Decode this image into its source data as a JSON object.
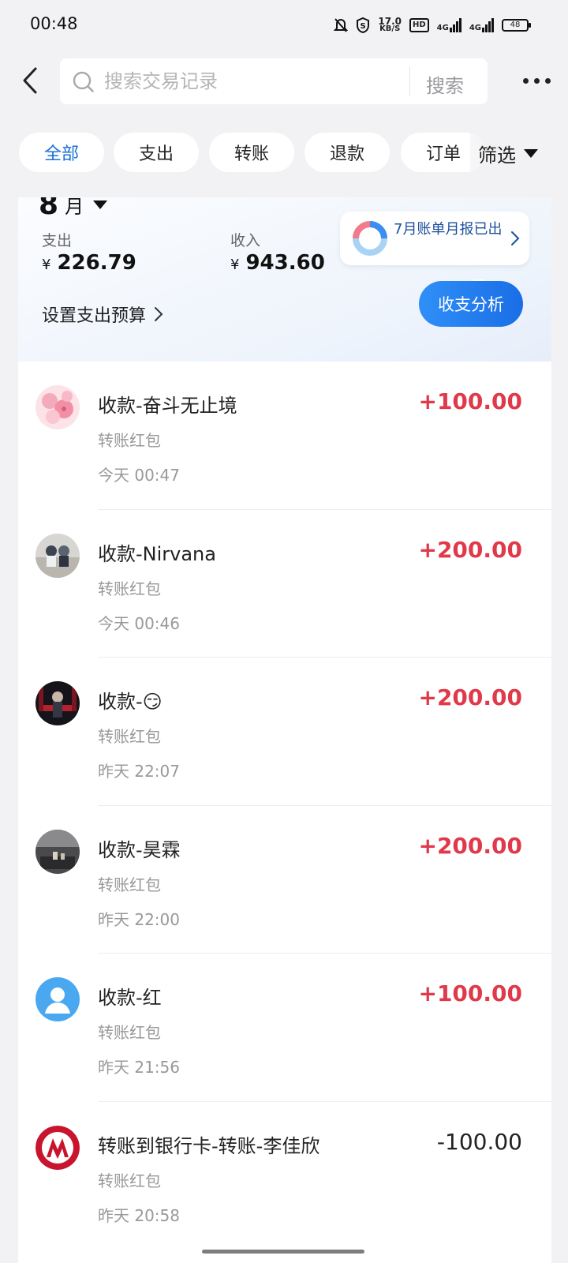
{
  "status_bar": {
    "time": "00:48",
    "net_speed_value": "17.0",
    "net_speed_unit": "KB/S",
    "hd_badge": "HD",
    "signal1": "4G",
    "signal2": "4G",
    "battery": "48"
  },
  "header": {
    "search_placeholder": "搜索交易记录",
    "search_button": "搜索"
  },
  "tabs": [
    {
      "label": "全部",
      "active": true
    },
    {
      "label": "支出",
      "active": false
    },
    {
      "label": "转账",
      "active": false
    },
    {
      "label": "退款",
      "active": false
    },
    {
      "label": "订单",
      "active": false
    }
  ],
  "filter_label": "筛选",
  "summary": {
    "month_number": "8",
    "month_unit": "月",
    "expense_label": "支出",
    "expense_currency": "¥",
    "expense_value": "226.79",
    "income_label": "收入",
    "income_currency": "¥",
    "income_value": "943.60",
    "report_text": "7月账单月报已出",
    "budget_label": "设置支出预算",
    "analysis_button": "收支分析"
  },
  "transactions": [
    {
      "title": "收款-奋斗无止境",
      "subtitle": "转账红包",
      "time": "今天 00:47",
      "amount": "+100.00",
      "direction": "in",
      "avatar": "pink-blossom"
    },
    {
      "title": "收款-Nirvana",
      "subtitle": "转账红包",
      "time": "今天 00:46",
      "amount": "+200.00",
      "direction": "in",
      "avatar": "figurine-photo"
    },
    {
      "title": "收款-😏",
      "subtitle": "转账红包",
      "time": "昨天 22:07",
      "amount": "+200.00",
      "direction": "in",
      "avatar": "stage-photo"
    },
    {
      "title": "收款-昊霖",
      "subtitle": "转账红包",
      "time": "昨天 22:00",
      "amount": "+200.00",
      "direction": "in",
      "avatar": "dark-photo"
    },
    {
      "title": "收款-红",
      "subtitle": "转账红包",
      "time": "昨天 21:56",
      "amount": "+100.00",
      "direction": "in",
      "avatar": "default-user"
    },
    {
      "title": "转账到银行卡-转账-李佳欣",
      "subtitle": "转账红包",
      "time": "昨天 20:58",
      "amount": "-100.00",
      "direction": "out",
      "avatar": "bank-logo"
    }
  ],
  "colors": {
    "accent_blue": "#1a6fd6",
    "income_red": "#e0394a",
    "background": "#f2f2f4"
  }
}
